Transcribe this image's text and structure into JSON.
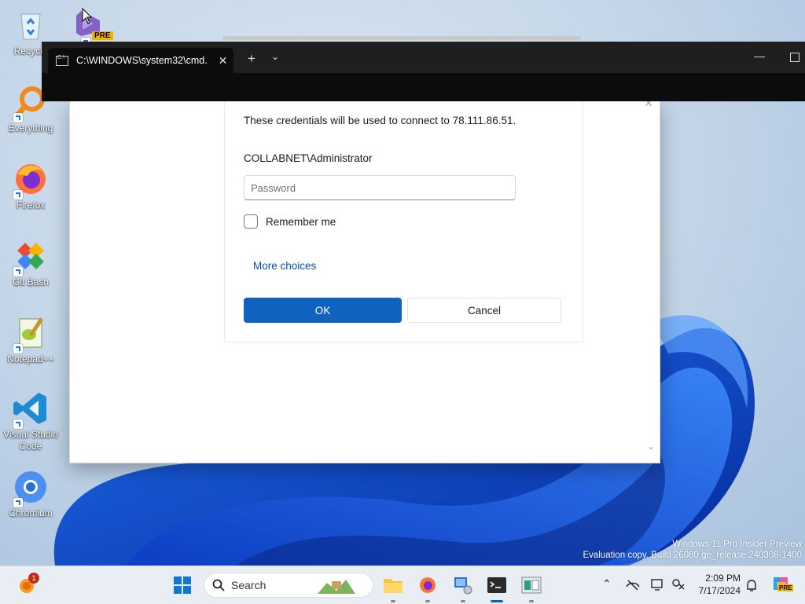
{
  "desktop": {
    "icons": [
      {
        "label": "Recycle"
      },
      {
        "label": "Everything"
      },
      {
        "label": "Firefox"
      },
      {
        "label": "Git Bash"
      },
      {
        "label": "Notepad++"
      },
      {
        "label": "Visual Studio Code"
      },
      {
        "label": "Chromium"
      }
    ],
    "vs_badge": "PRE"
  },
  "terminal": {
    "tab_title": "C:\\WINDOWS\\system32\\cmd.",
    "icon": "cmd-icon"
  },
  "dialog": {
    "credentials_text": "These credentials will be used to connect to 78.111.86.51.",
    "username": "COLLABNET\\Administrator",
    "password_placeholder": "Password",
    "password_value": "",
    "remember_label": "Remember me",
    "remember_checked": false,
    "more_choices_label": "More choices",
    "ok_label": "OK",
    "cancel_label": "Cancel"
  },
  "watermark": {
    "line1": "Windows 11 Pro Insider Preview",
    "line2": "Evaluation copy. Build 26080.ge_release.240308-1400"
  },
  "taskbar": {
    "notification_count": "1",
    "search_label": "Search",
    "clock_time": "2:09 PM",
    "clock_date": "7/17/2024",
    "copilot_badge": "PRE"
  },
  "colors": {
    "accent": "#0f62be",
    "terminal_bg": "#0c0c0c",
    "taskbar_bg": "#e9eef5"
  }
}
